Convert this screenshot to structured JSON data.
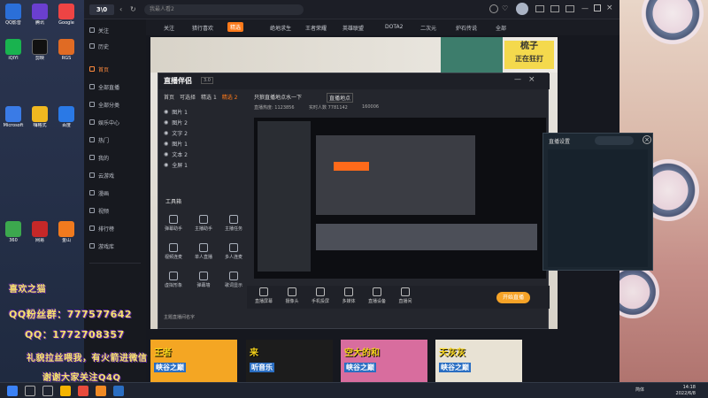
{
  "desktop": {
    "icons": [
      {
        "label": "QQ影音",
        "color": "#2b6fd8"
      },
      {
        "label": "腾讯",
        "color": "#6a3fcf"
      },
      {
        "label": "Google",
        "color": "#e44"
      },
      {
        "label": "iQIYI",
        "color": "#19b34f"
      },
      {
        "label": "剪映",
        "color": "#111"
      },
      {
        "label": "RGS",
        "color": "#e06b24"
      },
      {
        "label": "Microsoft",
        "color": "#3a7be6"
      },
      {
        "label": "嗨格式",
        "color": "#f0b820"
      },
      {
        "label": "百度",
        "color": "#2a79e6"
      },
      {
        "label": "360",
        "color": "#3ca84e"
      },
      {
        "label": "网易",
        "color": "#c62828"
      },
      {
        "label": "金山",
        "color": "#f07a1e"
      }
    ],
    "overlay": {
      "line1": "喜欢之猫",
      "line2": "QQ粉丝群：777577642",
      "line3": "QQ：1772708357",
      "line4": "礼貌拉丝喂我，有火箭进微信",
      "line5": "谢谢大家关注Q4Q"
    }
  },
  "browser": {
    "search_placeholder": "我最人看2",
    "sidebar": [
      "关注",
      "历史",
      "首页",
      "全部直播",
      "全部分类",
      "娱乐中心",
      "热门",
      "我的",
      "云游戏",
      "漫画",
      "视频",
      "排行榜",
      "游戏库"
    ],
    "categories": [
      "关注",
      "猎行喜欢",
      "和平精英",
      "绝地求生",
      "王者荣耀",
      "英雄联盟",
      "DOTA2",
      "二次元",
      "炉石传说",
      "全部"
    ],
    "highlight_label": "精选",
    "stream_banner": "梳子",
    "stream_banner_sub": "正在狂打"
  },
  "companion": {
    "title": "直播伴侣",
    "version": "3.0",
    "tabs": [
      "首页",
      "可选择",
      "精选 1",
      "精选 2"
    ],
    "layers": [
      "图片 1",
      "图片 2",
      "文字 2",
      "图片 1",
      "文本 2",
      "全屏 1"
    ],
    "tools_header": "工具箱",
    "tools": [
      "弹幕助手",
      "主播助手",
      "主播任务",
      "视频连麦",
      "单人直播",
      "多人连麦",
      "虚拟形象",
      "弹幕墙",
      "歌词显示"
    ],
    "stream_title": "只狼直播地点水一下",
    "hot_label": "直播地点",
    "stat_a": "直播热度: 1123856",
    "stat_b": "实时人数 7781142",
    "stat_c": "160006",
    "bottom_buttons": [
      "直播屏幕",
      "摄像头",
      "手机投屏",
      "多媒体",
      "直播设备",
      "直播间"
    ],
    "start_live": "开始直播",
    "footer": "主题直播间名字"
  },
  "darkpanel": {
    "title": "直播设置"
  },
  "thumbs": [
    {
      "top": "王者",
      "bottom": "峡谷之巅",
      "bg": "#f4a623"
    },
    {
      "top": "来",
      "bottom": "听音乐",
      "bg": "#1c1c1c"
    },
    {
      "top": "空大的和",
      "bottom": "峡谷之巅",
      "bg": "#d86d9e"
    },
    {
      "top": "天灰灰",
      "bottom": "峡谷之巅",
      "bg": "#e8e2d4"
    }
  ],
  "taskbar": {
    "time": "14:18",
    "date": "2022/6/8",
    "ime": "简体"
  }
}
